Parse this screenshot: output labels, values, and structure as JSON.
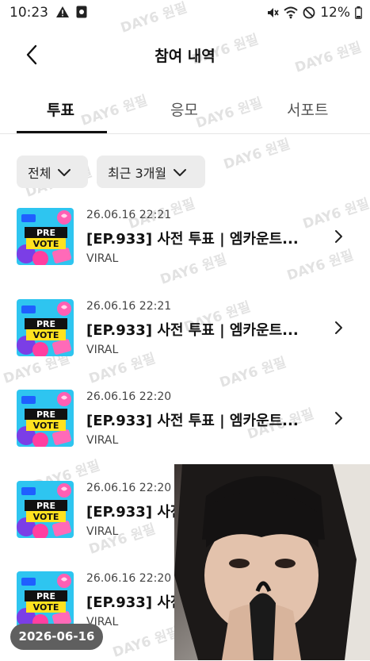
{
  "status_bar": {
    "time": "10:23",
    "battery": "12%"
  },
  "header": {
    "title": "참여 내역"
  },
  "tabs": [
    {
      "label": "투표",
      "active": true
    },
    {
      "label": "응모",
      "active": false
    },
    {
      "label": "서포트",
      "active": false
    }
  ],
  "filters": [
    {
      "label": "전체"
    },
    {
      "label": "최근 3개월"
    }
  ],
  "thumb": {
    "line1": "PRE",
    "line2": "VOTE"
  },
  "items": [
    {
      "date": "26.06.16 22:21",
      "title": "[EP.933] 사전 투표 | 엠카운트...",
      "subtitle": "VIRAL"
    },
    {
      "date": "26.06.16 22:21",
      "title": "[EP.933] 사전 투표 | 엠카운트...",
      "subtitle": "VIRAL"
    },
    {
      "date": "26.06.16 22:20",
      "title": "[EP.933] 사전 투표 | 엠카운트...",
      "subtitle": "VIRAL"
    },
    {
      "date": "26.06.16 22:20",
      "title": "[EP.933] 사전 투표 | 엠카운트...",
      "subtitle": "VIRAL"
    },
    {
      "date": "26.06.16 22:20",
      "title": "[EP.933] 사전 투표 | 엠카운트...",
      "subtitle": "VIRAL"
    }
  ],
  "date_badge": "2026-06-16",
  "watermark": "DAY6 원필",
  "colors": {
    "text": "#111111",
    "filter_bg": "#ececec",
    "badge_bg": "#5f5f5f"
  }
}
